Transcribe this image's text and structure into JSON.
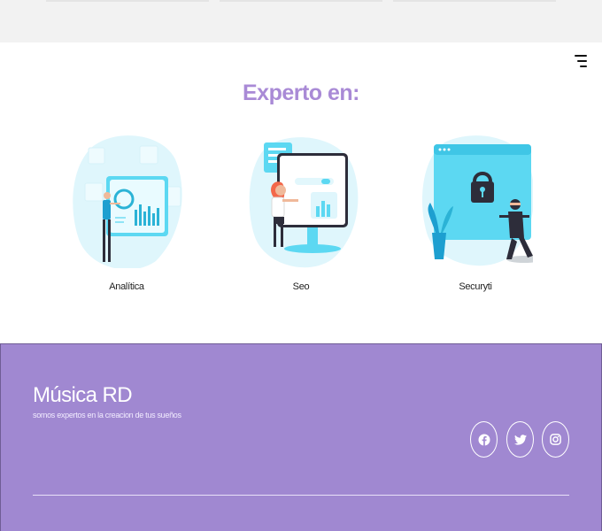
{
  "nav": {
    "menu_icon": "menu-icon"
  },
  "experto": {
    "title": "Experto en:",
    "services": [
      {
        "label": "Analítica",
        "icon": "analytics-illustration"
      },
      {
        "label": "Seo",
        "icon": "seo-illustration"
      },
      {
        "label": "Securyti",
        "icon": "security-illustration"
      }
    ]
  },
  "footer": {
    "brand": "Música RD",
    "tagline": "somos expertos en la creacion de tus sueños",
    "social": [
      {
        "icon": "facebook-icon"
      },
      {
        "icon": "twitter-icon"
      },
      {
        "icon": "instagram-icon"
      }
    ]
  },
  "colors": {
    "accent": "#a98ad6",
    "footer_bg": "#a088d1",
    "illustration": "#5cd8f2"
  }
}
